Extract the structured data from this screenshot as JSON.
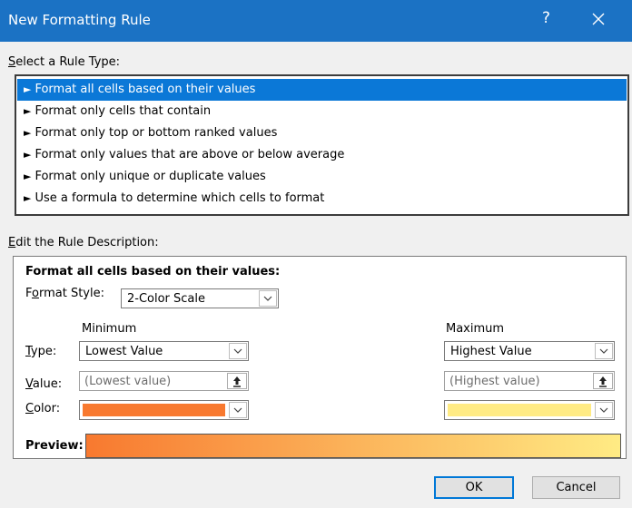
{
  "window": {
    "title": "New Formatting Rule",
    "help_glyph": "?"
  },
  "rule_type": {
    "label_key": "S",
    "label_rest": "elect a Rule Type:",
    "items": [
      "Format all cells based on their values",
      "Format only cells that contain",
      "Format only top or bottom ranked values",
      "Format only values that are above or below average",
      "Format only unique or duplicate values",
      "Use a formula to determine which cells to format"
    ],
    "selected_index": 0
  },
  "description": {
    "label_key": "E",
    "label_rest": "dit the Rule Description:",
    "heading": "Format all cells based on their values:",
    "format_style_key": "o",
    "format_style_pre": "F",
    "format_style_post": "rmat Style:",
    "format_style_value": "2-Color Scale",
    "minimum_header": "Minimum",
    "maximum_header": "Maximum",
    "type_key": "T",
    "type_rest": "ype:",
    "value_key": "V",
    "value_rest": "alue:",
    "color_key": "C",
    "color_rest": "olor:",
    "min_type": "Lowest Value",
    "max_type": "Highest Value",
    "min_value_placeholder": "(Lowest value)",
    "max_value_placeholder": "(Highest value)",
    "min_color": "#f8792f",
    "max_color": "#ffeb84",
    "preview_label": "Preview:"
  },
  "buttons": {
    "ok": "OK",
    "cancel": "Cancel"
  }
}
